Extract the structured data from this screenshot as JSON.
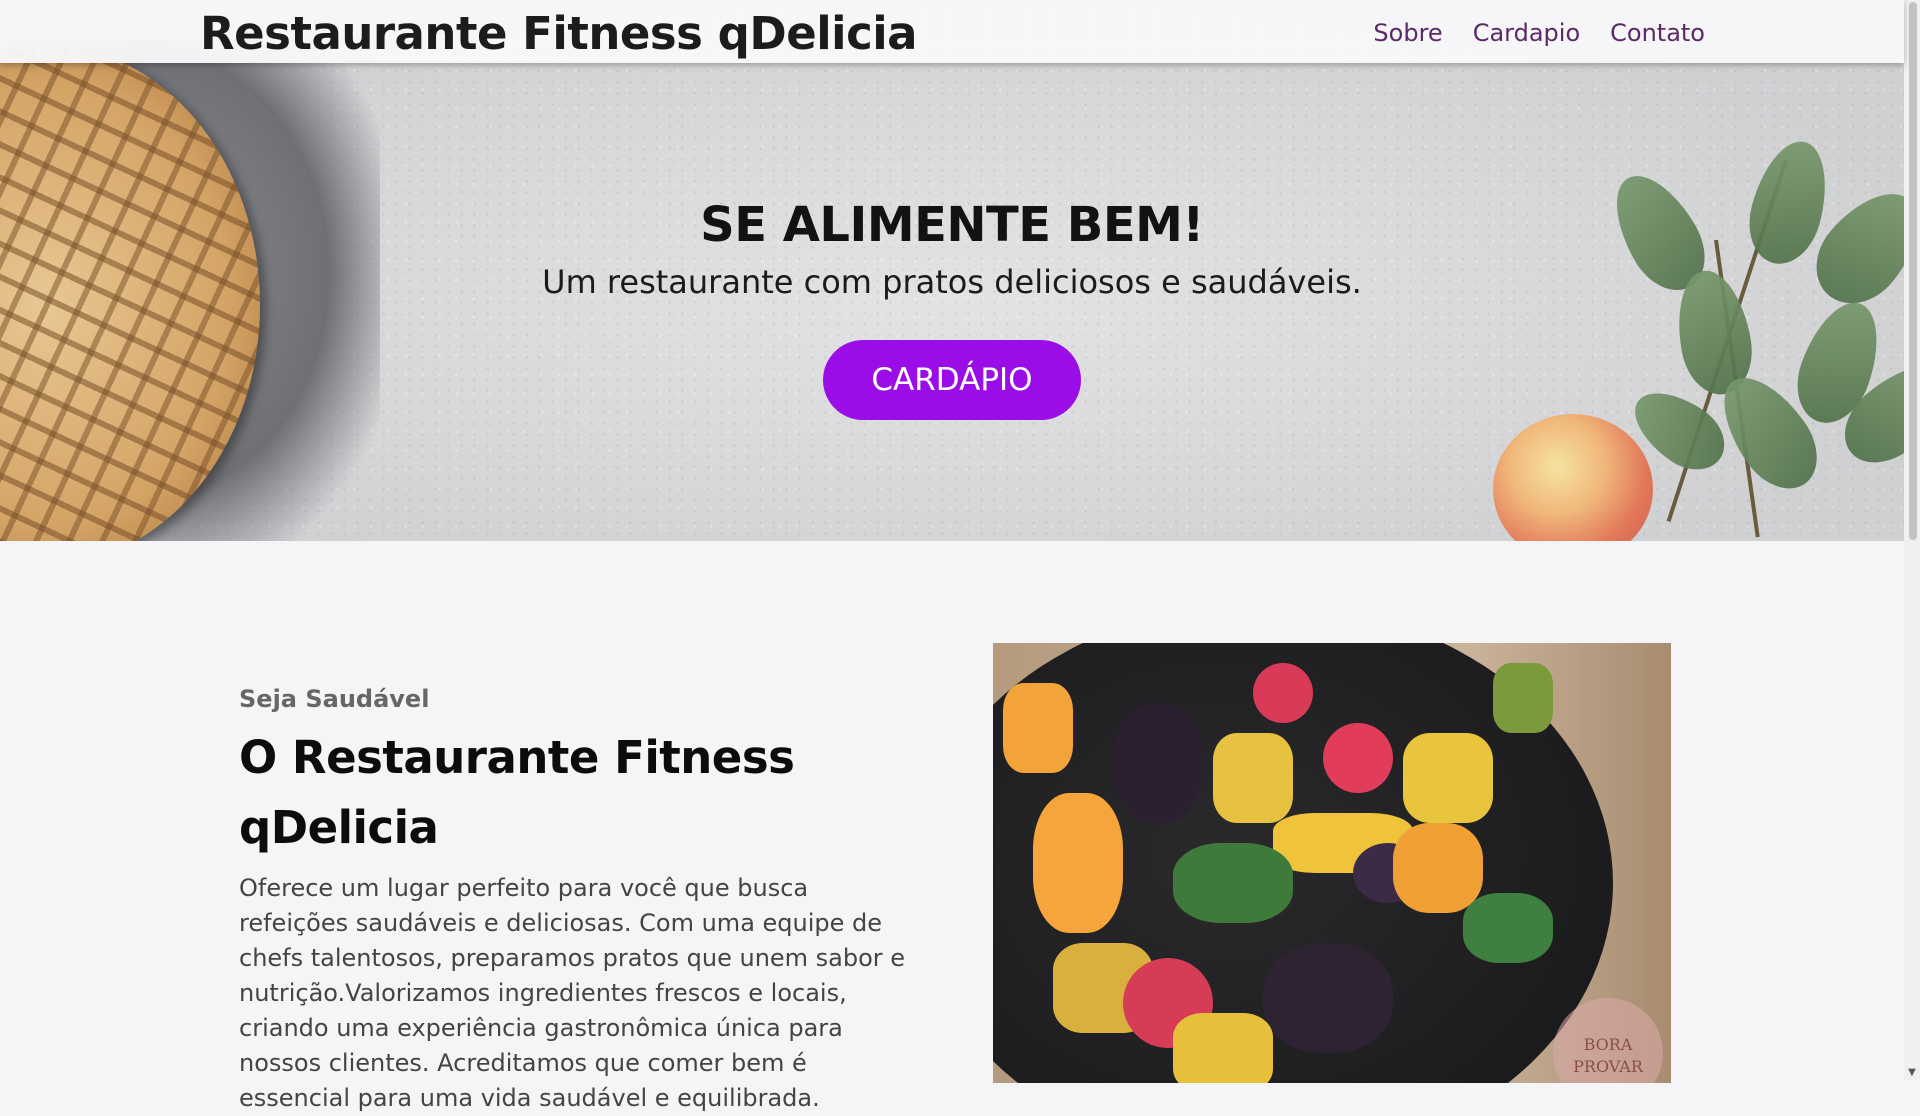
{
  "header": {
    "brand": "Restaurante Fitness qDelicia",
    "nav": [
      "Sobre",
      "Cardapio",
      "Contato"
    ]
  },
  "hero": {
    "title": "SE ALIMENTE BEM!",
    "subtitle": "Um restaurante com pratos deliciosos e saudáveis.",
    "button": "CARDÁPIO",
    "button_color": "#9b0de6"
  },
  "about": {
    "kicker": "Seja Saudável",
    "title_line1": "O Restaurante Fitness",
    "title_line2": "qDelicia",
    "body": "Oferece um lugar perfeito para você que busca refeições saudáveis e deliciosas. Com uma equipe de chefs talentosos, preparamos pratos que unem sabor e nutrição.Valorizamos ingredientes frescos e locais, criando uma experiência gastronômica única para nossos clientes. Acreditamos que comer bem é essencial para uma vida saudável e equilibrada.",
    "image_stamp_line1": "BORA",
    "image_stamp_line2": "PROVAR"
  },
  "colors": {
    "nav_link": "#5a2a66",
    "accent": "#9b0de6"
  }
}
